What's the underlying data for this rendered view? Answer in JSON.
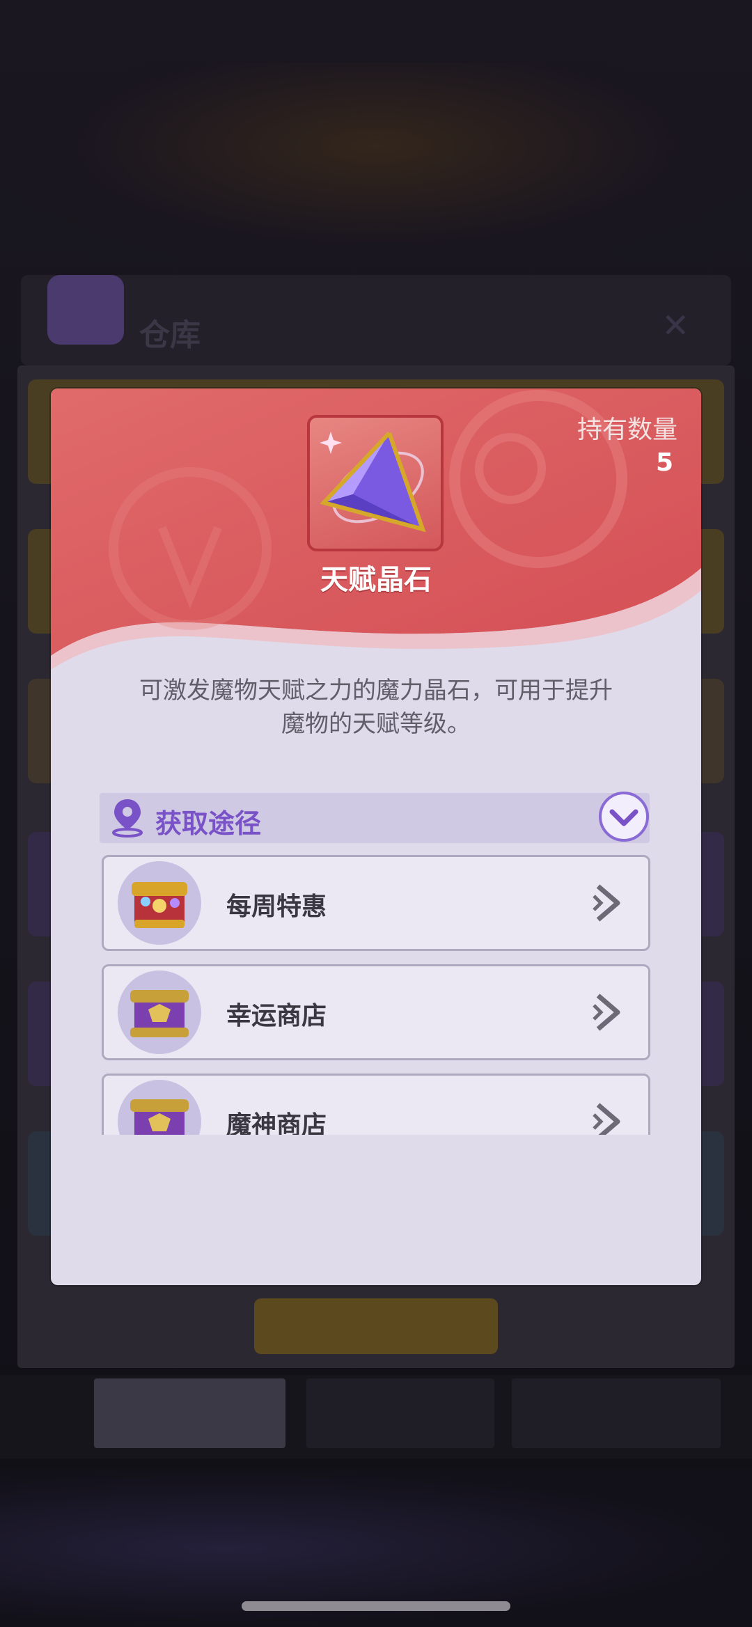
{
  "background": {
    "title": "仓库"
  },
  "modal": {
    "item_name": "天赋晶石",
    "count_label": "持有数量",
    "count_value": "5",
    "description_line1": "可激发魔物天赋之力的魔力晶石，可用于提升",
    "description_line2": "魔物的天赋等级。",
    "source_title": "获取途径",
    "sources": [
      {
        "label": "每周特惠",
        "icon": "treasure-chest-icon"
      },
      {
        "label": "幸运商店",
        "icon": "purple-chest-icon"
      },
      {
        "label": "魔神商店",
        "icon": "purple-chest-icon"
      }
    ]
  },
  "colors": {
    "header_red": "#d9595c",
    "panel": "#dfdbea",
    "accent_purple": "#7a52c8"
  }
}
